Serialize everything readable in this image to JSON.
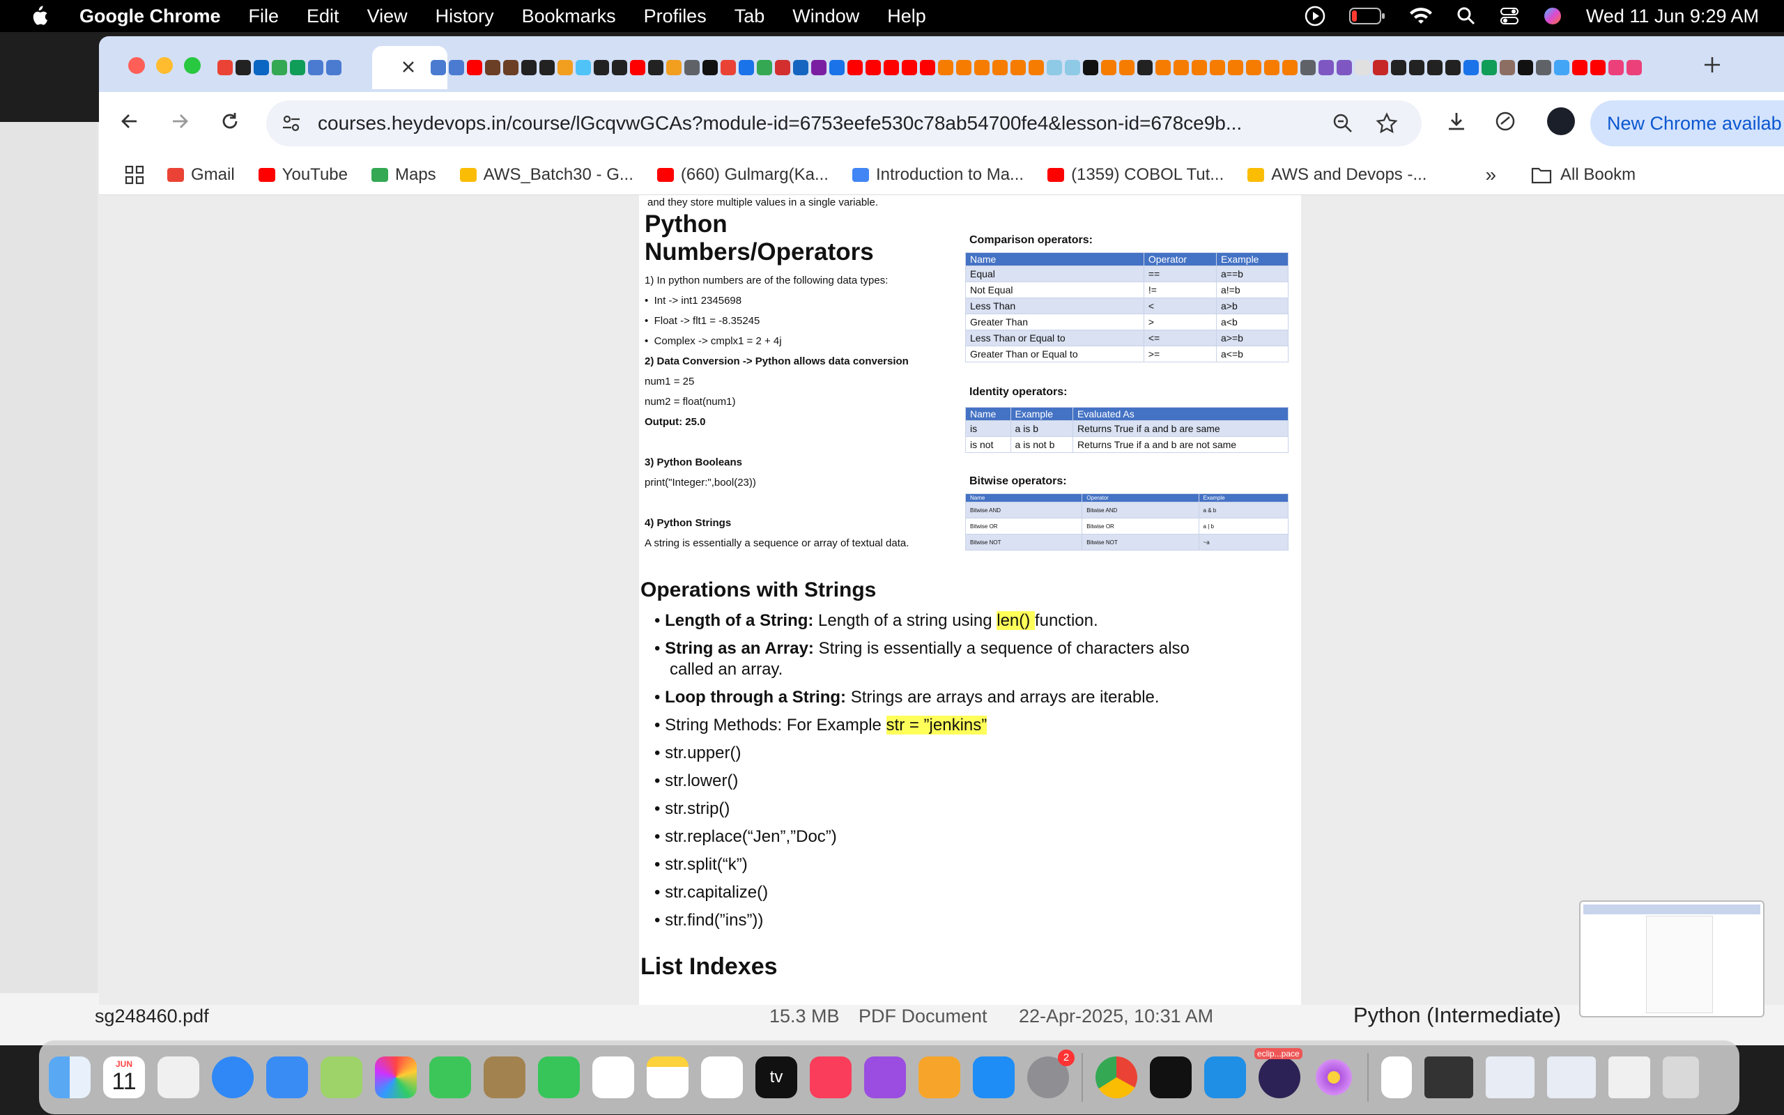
{
  "menubar": {
    "app": "Google Chrome",
    "items": [
      "File",
      "Edit",
      "View",
      "History",
      "Bookmarks",
      "Profiles",
      "Tab",
      "Window",
      "Help"
    ],
    "clock": "Wed 11 Jun  9:29 AM"
  },
  "browser": {
    "url": "courses.heydevops.in/course/lGcqvwGCAs?module-id=6753eefe530c78ab54700fe4&lesson-id=678ce9b...",
    "update_button": "New Chrome availab",
    "bookmarks": [
      "Gmail",
      "YouTube",
      "Maps",
      "AWS_Batch30 - G...",
      "(660) Gulmarg(Ka...",
      "Introduction to Ma...",
      "(1359) COBOL Tut...",
      "AWS and Devops -..."
    ],
    "all_bookmarks": "All Bookm",
    "bookmark_colors": [
      "#ea4335",
      "#ff0000",
      "#34a853",
      "#fbbc04",
      "#ff0000",
      "#4285f4",
      "#ff0000",
      "#fbbc04"
    ]
  },
  "doc": {
    "top_fragment": "and they store multiple values in a single variable.",
    "numbers_title_1": "Python",
    "numbers_title_2": "Numbers/Operators",
    "numbers_lines": [
      "1) In python numbers are of the following data types:",
      "Int -> int1 2345698",
      "Float -> flt1 = -8.35245",
      "Complex -> cmplx1 = 2 + 4j",
      "2) Data Conversion -> Python allows data conversion",
      "num1 = 25",
      "num2 = float(num1)",
      "Output: 25.0",
      "3) Python Booleans",
      "print(\"Integer:\",bool(23))",
      "4) Python Strings",
      "A string is essentially a sequence or array of textual data."
    ],
    "comparison_title": "Comparison operators:",
    "comparison_headers": [
      "Name",
      "Operator",
      "Example"
    ],
    "comparison_rows": [
      [
        "Equal",
        "==",
        "a==b"
      ],
      [
        "Not Equal",
        "!=",
        "a!=b"
      ],
      [
        "Less Than",
        "<",
        "a>b"
      ],
      [
        "Greater Than",
        ">",
        "a<b"
      ],
      [
        "Less Than or Equal to",
        "<=",
        "a>=b"
      ],
      [
        "Greater Than or Equal to",
        ">=",
        "a<=b"
      ]
    ],
    "identity_title": "Identity operators:",
    "identity_headers": [
      "Name",
      "Example",
      "Evaluated As"
    ],
    "identity_rows": [
      [
        "is",
        "a is b",
        "Returns True if a and b are same"
      ],
      [
        "is not",
        "a is not b",
        "Returns True if a and b are not same"
      ]
    ],
    "bitwise_title": "Bitwise operators:",
    "bitwise_headers": [
      "Name",
      "Operator",
      "Example"
    ],
    "bitwise_rows": [
      [
        "Bitwise AND",
        "Bitwise AND",
        "a & b"
      ],
      [
        "Bitwise OR",
        "Bitwise OR",
        "a | b"
      ],
      [
        "Bitwise NOT",
        "Bitwise NOT",
        "~a"
      ]
    ],
    "strings_title": "Operations with Strings",
    "strings_items": [
      {
        "bold": "Length of a String:",
        "text": " Length of a string using ",
        "hl": "len() ",
        "tail": "function."
      },
      {
        "bold": "String as an Array:",
        "text": "  String is essentially a sequence of characters also called an array.",
        "hl": "",
        "tail": ""
      },
      {
        "bold": "Loop through a String:",
        "text": " Strings are arrays and arrays are iterable.",
        "hl": "",
        "tail": ""
      },
      {
        "bold": "",
        "text": "String Methods: For Example ",
        "hl": "str = ”jenkins”",
        "tail": ""
      },
      {
        "bold": "",
        "text": "str.upper()",
        "hl": "",
        "tail": ""
      },
      {
        "bold": "",
        "text": "str.lower()",
        "hl": "",
        "tail": ""
      },
      {
        "bold": "",
        "text": "str.strip()",
        "hl": "",
        "tail": ""
      },
      {
        "bold": "",
        "text": "str.replace(“Jen”,”Doc”)",
        "hl": "",
        "tail": ""
      },
      {
        "bold": "",
        "text": "str.split(“k”)",
        "hl": "",
        "tail": ""
      },
      {
        "bold": "",
        "text": "str.capitalize()",
        "hl": "",
        "tail": ""
      },
      {
        "bold": "",
        "text": "str.find(”ins”))",
        "hl": "",
        "tail": ""
      }
    ],
    "list_title": "List Indexes"
  },
  "background": {
    "file_name": "sg248460.pdf",
    "file_size": "15.3 MB",
    "file_kind": "PDF Document",
    "file_date": "22-Apr-2025, 10:31 AM",
    "right_label": "Python (Intermediate)"
  },
  "dock": {
    "calendar_month": "JUN",
    "calendar_day": "11",
    "settings_badge": "2",
    "eclipse_label": "eclip...pace",
    "appletv_label": "tv"
  }
}
